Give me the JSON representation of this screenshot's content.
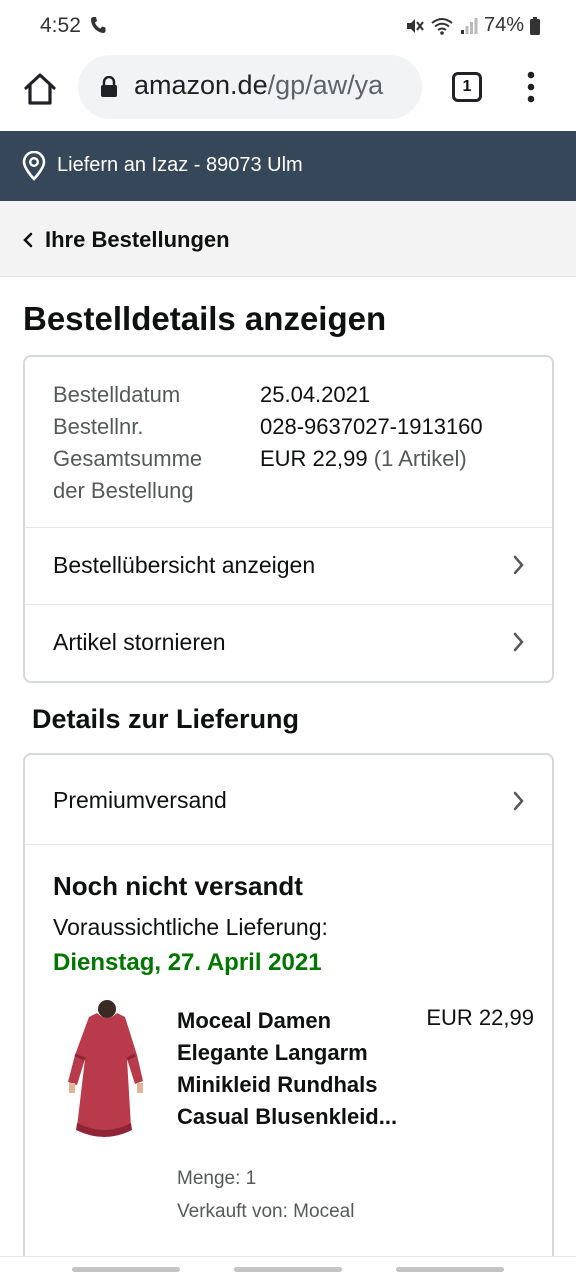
{
  "status_bar": {
    "time": "4:52",
    "battery": "74%"
  },
  "browser": {
    "url_domain": "amazon.de",
    "url_path": "/gp/aw/ya",
    "tab_count": "1"
  },
  "deliver_bar": {
    "text": "Liefern an Izaz - 89073 Ulm"
  },
  "back_link": {
    "label": "Ihre Bestellungen"
  },
  "page_title": "Bestelldetails anzeigen",
  "order_info": {
    "date_label": "Bestelldatum",
    "date_value": "25.04.2021",
    "number_label": "Bestellnr.",
    "number_value": "028-9637027-1913160",
    "total_label_line1": "Gesamtsumme",
    "total_label_line2": "der Bestellung",
    "total_value": "EUR 22,99",
    "total_items": "(1 Artikel)"
  },
  "order_links": {
    "summary": "Bestellübersicht anzeigen",
    "cancel": "Artikel stornieren"
  },
  "delivery_section": {
    "title": "Details zur Lieferung",
    "shipping_method": "Premiumversand",
    "status": "Noch nicht versandt",
    "expected_label": "Voraussichtliche Lieferung:",
    "expected_date": "Dienstag, 27. April 2021",
    "date_color": "#007600"
  },
  "product": {
    "name": "Moceal Damen Elegante Langarm Minikleid Rundhals Casual Blusenkleid...",
    "price": "EUR 22,99",
    "quantity": "Menge: 1",
    "seller": "Verkauft von: Moceal",
    "image_color": "#b83a4b"
  },
  "colors": {
    "header_bg": "#37475a",
    "back_bar_bg": "#f3f3f3"
  }
}
